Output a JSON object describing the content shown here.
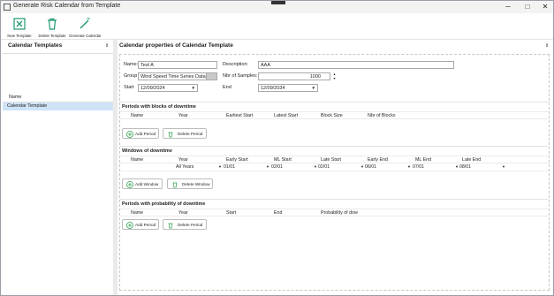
{
  "window": {
    "title": "Generate Risk Calendar from Template",
    "controls": [
      "─",
      "□",
      "✕"
    ]
  },
  "toolbar": {
    "new_template": "New Template",
    "delete_template": "Delete Template",
    "generate_calendar": "Generate Calendar"
  },
  "left": {
    "title": "Calendar Templates",
    "pin": "⇕",
    "column_header": "Name",
    "items": [
      "Calendar Template"
    ]
  },
  "right": {
    "title": "Calendar properties of Calendar Template",
    "pin": "⇕"
  },
  "form": {
    "name_label": "Name:",
    "name_value": "Test A",
    "description_label": "Description:",
    "description_value": "AAA",
    "group_label": "Group",
    "group_value": "Wind Speed Time Series Data",
    "samples_label": "Nbr of Samples:",
    "samples_value": "1000",
    "start_label": "Start",
    "start_value": "12/09/2024",
    "end_label": "End",
    "end_value": "12/09/2034"
  },
  "sections": {
    "blocks": {
      "title": "Periods with blocks of downtime",
      "columns": [
        "Name",
        "Year",
        "Earliest Start",
        "Latest Start",
        "Block Size",
        "Nbr of Blocks"
      ],
      "add": "Add Period",
      "delete": "Delete Period"
    },
    "windows": {
      "title": "Windows of downtime",
      "columns": [
        "Name",
        "Year",
        "Early Start",
        "ML Start",
        "Late Start",
        "Early End",
        "ML End",
        "Late End"
      ],
      "row": [
        "",
        "All Years",
        "01/01",
        "02/01",
        "02/01",
        "06/01",
        "07/01",
        "08/01"
      ],
      "add": "Add Window",
      "delete": "Delete Window"
    },
    "probability": {
      "title": "Periods with probability of downtime",
      "columns": [
        "Name",
        "Year",
        "Start",
        "End",
        "Probability of dow"
      ],
      "add": "Add Period",
      "delete": "Delete Period"
    }
  },
  "colors": {
    "selected_row": "#cfe3f7",
    "add_icon": "#2e9e4e",
    "delete_icon": "#2e9e4e",
    "toolbar_icon": "#1d9a6c"
  }
}
